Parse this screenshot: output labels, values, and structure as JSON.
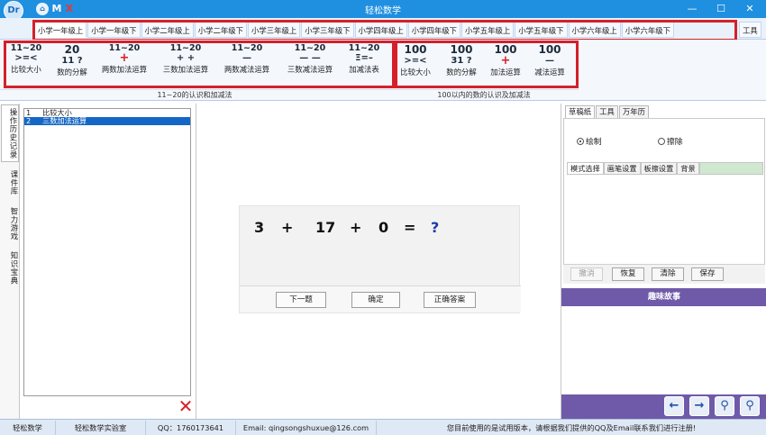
{
  "titlebar": {
    "title": "轻松数学",
    "logo_glyph": "Dr",
    "home_glyph": "⌂",
    "menu_m": "M",
    "menu_x": "X",
    "minimize": "—",
    "maximize": "☐",
    "close": "✕"
  },
  "grade_tabs": [
    "小学一年级上",
    "小学一年级下",
    "小学二年级上",
    "小学二年级下",
    "小学三年级上",
    "小学三年级下",
    "小学四年级上",
    "小学四年级下",
    "小学五年级上",
    "小学五年级下",
    "小学六年级上",
    "小学六年级下"
  ],
  "tools_tab": "工具",
  "ribbon": {
    "items": [
      {
        "top": "11~20",
        "mid": ">=<",
        "label": "比较大小"
      },
      {
        "top": "20",
        "mid": "11 ?",
        "label": "数的分解"
      },
      {
        "top": "11~20",
        "mid": "+",
        "label": "两数加法运算"
      },
      {
        "top": "11~20",
        "mid": "+ +",
        "label": "三数加法运算"
      },
      {
        "top": "11~20",
        "mid": "—",
        "label": "两数减法运算"
      },
      {
        "top": "11~20",
        "mid": "— —",
        "label": "三数减法运算"
      },
      {
        "top": "11~20",
        "mid": "Ξ=–",
        "label": "加减法表"
      },
      {
        "top": "100",
        "mid": ">=<",
        "label": "比较大小"
      },
      {
        "top": "100",
        "mid": "31 ?",
        "label": "数的分解"
      },
      {
        "top": "100",
        "mid": "+",
        "label": "加法运算"
      },
      {
        "top": "100",
        "mid": "—",
        "label": "减法运算"
      }
    ],
    "group1_caption": "11~20的认识和加减法",
    "group2_caption": "100以内的数的认识及加减法"
  },
  "sidebar_tabs": [
    "操作历史记录",
    "课件库",
    "智力游戏",
    "知识宝典"
  ],
  "history": {
    "rows": [
      {
        "index": "1",
        "text": "比较大小"
      },
      {
        "index": "2",
        "text": "三数加法运算"
      }
    ],
    "delete_icon": "✕"
  },
  "exercise": {
    "tokens": [
      "3",
      "+",
      "17",
      "+",
      "0",
      "=",
      "?"
    ],
    "buttons": {
      "next": "下一题",
      "confirm": "确定",
      "answer": "正确答案"
    }
  },
  "right_panel": {
    "tabs": [
      "草稿纸",
      "工具",
      "万年历"
    ],
    "radio_draw": "绘制",
    "radio_erase": "擦除",
    "sub_tabs": [
      "模式选择",
      "画笔设置",
      "板擦设置",
      "背景"
    ],
    "actions": [
      "撤消",
      "恢复",
      "清除",
      "保存"
    ],
    "story_title": "趣味故事",
    "nav_icons": [
      "←",
      "→",
      "⚲",
      "⚲"
    ]
  },
  "statusbar": {
    "app": "轻松数学",
    "lab": "轻松数学实验室",
    "qq": "QQ：1760173641",
    "email": "Email: qingsongshuxue@126.com",
    "notice": "您目前使用的是试用版本，请根据我们提供的QQ及Email联系我们进行注册!"
  }
}
